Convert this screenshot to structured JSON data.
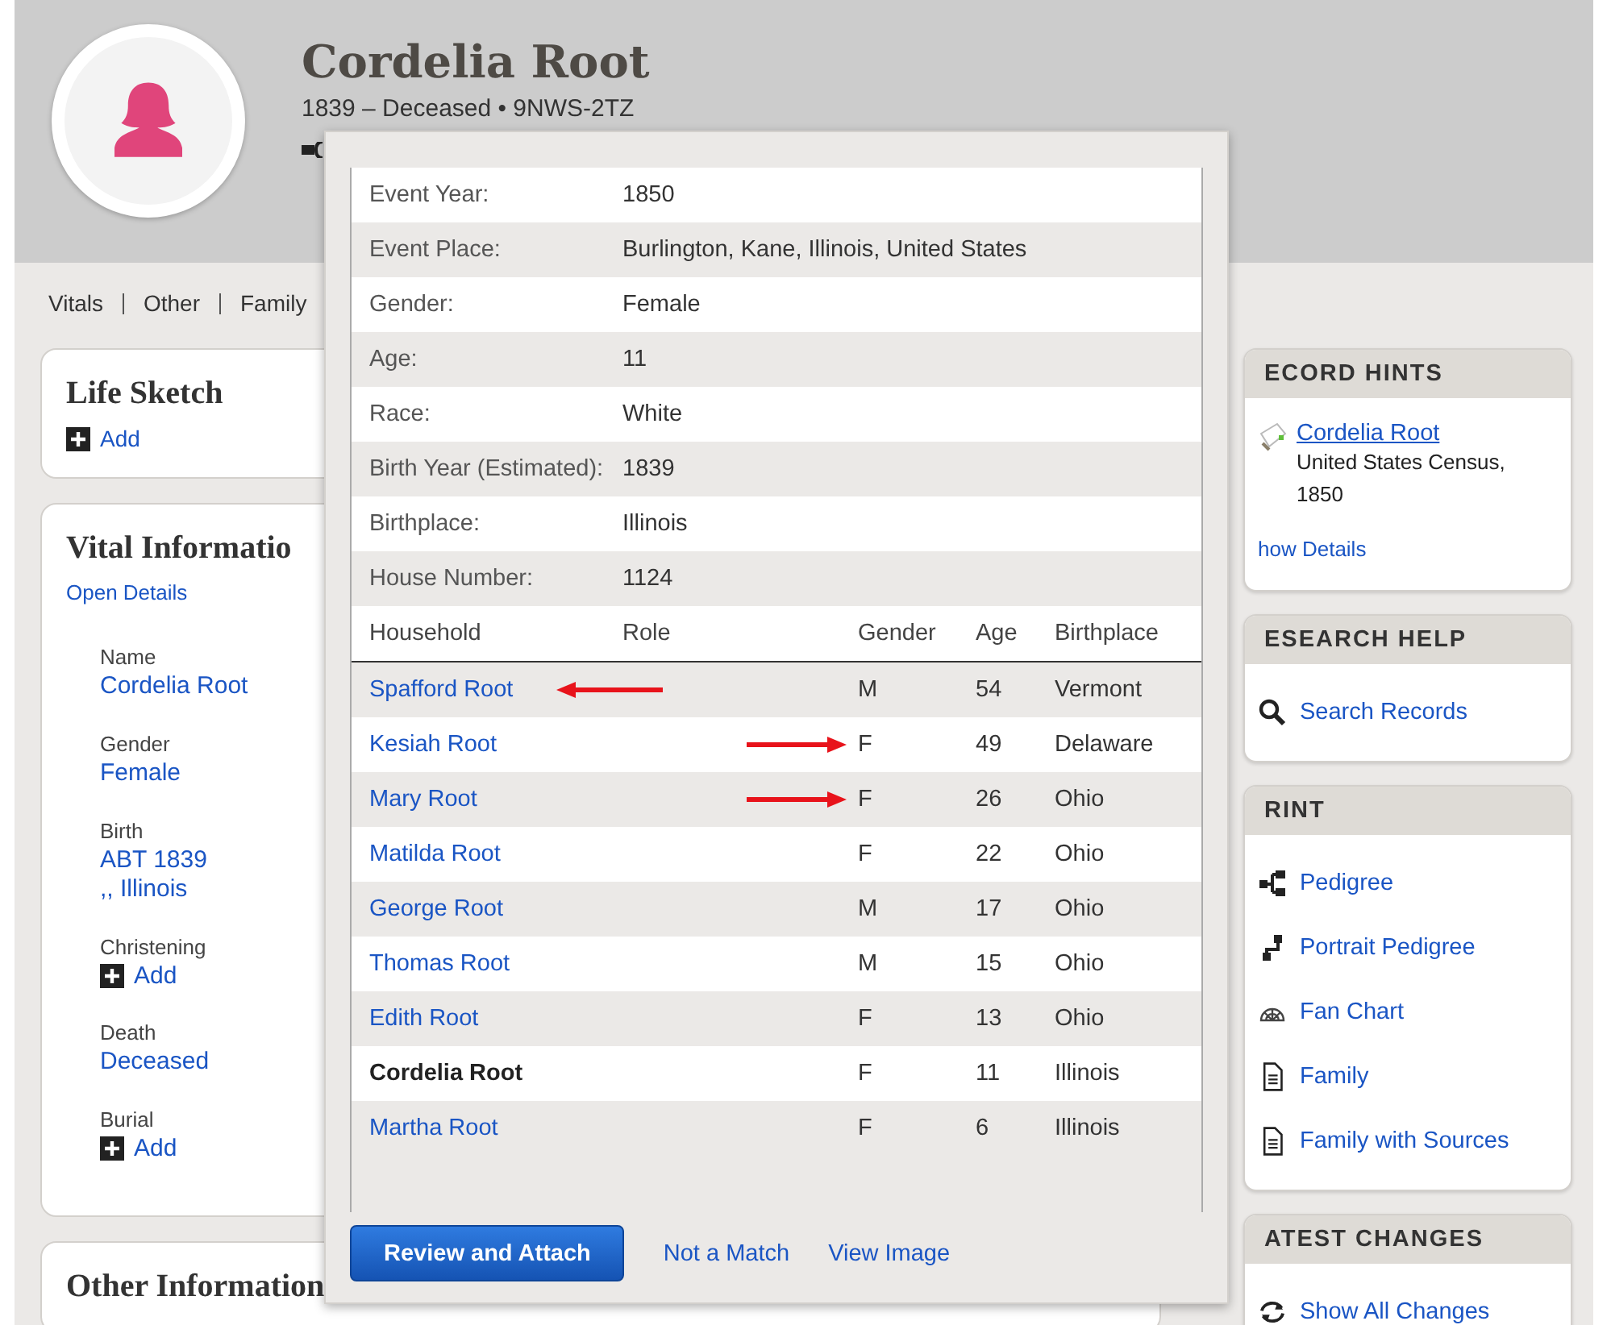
{
  "header": {
    "name": "Cordelia Root",
    "subtitle": "1839 – Deceased • 9NWS-2TZ"
  },
  "nav": [
    "Vitals",
    "Other",
    "Family"
  ],
  "life_sketch": {
    "title": "Life Sketch",
    "add": "Add"
  },
  "vital_information": {
    "title": "Vital Informatio",
    "open_details": "Open Details",
    "fields": [
      {
        "label": "Name",
        "kind": "value",
        "values": [
          "Cordelia Root"
        ]
      },
      {
        "label": "Gender",
        "kind": "value",
        "values": [
          "Female"
        ]
      },
      {
        "label": "Birth",
        "kind": "value",
        "values": [
          "ABT 1839",
          ",, Illinois"
        ]
      },
      {
        "label": "Christening",
        "kind": "add",
        "values": [
          "Add"
        ]
      },
      {
        "label": "Death",
        "kind": "value",
        "values": [
          "Deceased"
        ]
      },
      {
        "label": "Burial",
        "kind": "add",
        "values": [
          "Add"
        ]
      }
    ]
  },
  "other_information": {
    "title": "Other Information"
  },
  "record_popup": {
    "details": [
      {
        "label": "Event Year:",
        "value": "1850"
      },
      {
        "label": "Event Place:",
        "value": "Burlington, Kane, Illinois, United States"
      },
      {
        "label": "Gender:",
        "value": "Female"
      },
      {
        "label": "Age:",
        "value": "11"
      },
      {
        "label": "Race:",
        "value": "White"
      },
      {
        "label": "Birth Year (Estimated):",
        "value": "1839"
      },
      {
        "label": "Birthplace:",
        "value": "Illinois"
      },
      {
        "label": "House Number:",
        "value": "1124"
      }
    ],
    "household": {
      "columns": [
        "Household",
        "Role",
        "Gender",
        "Age",
        "Birthplace"
      ],
      "rows": [
        {
          "name": "Spafford Root",
          "gender": "M",
          "age": "54",
          "birthplace": "Vermont",
          "current": false,
          "kind": "arrow_left"
        },
        {
          "name": "Kesiah Root",
          "gender": "F",
          "age": "49",
          "birthplace": "Delaware",
          "current": false,
          "kind": "arrow_right"
        },
        {
          "name": "Mary Root",
          "gender": "F",
          "age": "26",
          "birthplace": "Ohio",
          "current": false,
          "kind": "arrow_right"
        },
        {
          "name": "Matilda Root",
          "gender": "F",
          "age": "22",
          "birthplace": "Ohio",
          "current": false
        },
        {
          "name": "George Root",
          "gender": "M",
          "age": "17",
          "birthplace": "Ohio",
          "current": false
        },
        {
          "name": "Thomas Root",
          "gender": "M",
          "age": "15",
          "birthplace": "Ohio",
          "current": false
        },
        {
          "name": "Edith Root",
          "gender": "F",
          "age": "13",
          "birthplace": "Ohio",
          "current": false
        },
        {
          "name": "Cordelia Root",
          "gender": "F",
          "age": "11",
          "birthplace": "Illinois",
          "current": true
        },
        {
          "name": "Martha Root",
          "gender": "F",
          "age": "6",
          "birthplace": "Illinois",
          "current": false
        }
      ]
    },
    "buttons": [
      {
        "label": "Review and Attach",
        "kind": "primary"
      },
      {
        "label": "Not a Match",
        "kind": "link"
      },
      {
        "label": "View Image",
        "kind": "link"
      }
    ]
  },
  "sidebar": [
    {
      "title": "ECORD HINTS",
      "kind": "hints",
      "hint": {
        "title": "Cordelia Root",
        "source": "United States Census, 1850"
      },
      "link": "how Details"
    },
    {
      "title": "ESEARCH HELP",
      "kind": "links",
      "items": [
        {
          "label": "Search Records",
          "kind": "search"
        }
      ]
    },
    {
      "title": "RINT",
      "kind": "links",
      "items": [
        {
          "label": "Pedigree",
          "kind": "pedigree"
        },
        {
          "label": "Portrait Pedigree",
          "kind": "portrait"
        },
        {
          "label": "Fan Chart",
          "kind": "fan"
        },
        {
          "label": "Family",
          "kind": "document"
        },
        {
          "label": "Family with Sources",
          "kind": "document"
        }
      ]
    },
    {
      "title": "ATEST CHANGES",
      "kind": "links",
      "items": [
        {
          "label": "Show All Changes",
          "kind": "refresh"
        }
      ]
    }
  ]
}
